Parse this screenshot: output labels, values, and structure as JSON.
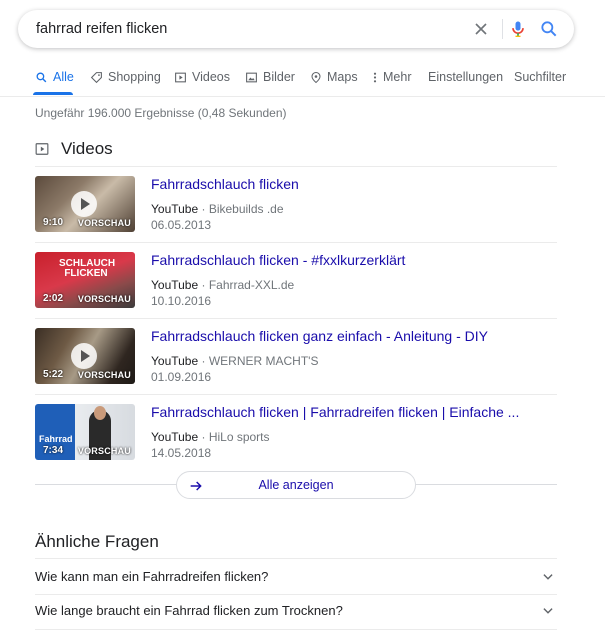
{
  "search": {
    "query": "fahrrad reifen flicken"
  },
  "tabs": [
    {
      "label": "Alle",
      "icon": "search-icon",
      "active": true
    },
    {
      "label": "Shopping",
      "icon": "tag-icon"
    },
    {
      "label": "Videos",
      "icon": "video-icon"
    },
    {
      "label": "Bilder",
      "icon": "image-icon"
    },
    {
      "label": "Maps",
      "icon": "map-pin-icon"
    },
    {
      "label": "Mehr",
      "icon": "more-vert-icon"
    },
    {
      "label": "Einstellungen"
    },
    {
      "label": "Suchfilter"
    }
  ],
  "result_stats": "Ungefähr 196.000 Ergebnisse (0,48 Sekunden)",
  "videos": {
    "heading": "Videos",
    "items": [
      {
        "title": "Fahrradschlauch flicken",
        "platform": "YouTube",
        "channel": " · Bikebuilds .de",
        "date": "06.05.2013",
        "duration": "9:10",
        "preview": "VORSCHAU"
      },
      {
        "title": "Fahrradschlauch flicken - #fxxlkurzerklärt",
        "platform": "YouTube",
        "channel": " · Fahrrad-XXL.de",
        "date": "10.10.2016",
        "duration": "2:02",
        "preview": "VORSCHAU",
        "thumb_text": "SCHLAUCH FLICKEN"
      },
      {
        "title": "Fahrradschlauch flicken ganz einfach - Anleitung - DIY",
        "platform": "YouTube",
        "channel": " · WERNER MACHT'S",
        "date": "01.09.2016",
        "duration": "5:22",
        "preview": "VORSCHAU"
      },
      {
        "title": "Fahrradschlauch flicken | Fahrradreifen flicken | Einfache ...",
        "platform": "YouTube",
        "channel": " · HiLo sports",
        "date": "14.05.2018",
        "duration": "7:34",
        "preview": "VORSCHAU",
        "thumb_text": "Fahrrad"
      }
    ],
    "show_all": "Alle anzeigen"
  },
  "paa": {
    "heading": "Ähnliche Fragen",
    "questions": [
      "Wie kann man ein Fahrradreifen flicken?",
      "Wie lange braucht ein Fahrrad flicken zum Trocknen?"
    ]
  },
  "colors": {
    "link": "#1a0dab",
    "accent": "#1a73e8",
    "muted": "#70757a"
  }
}
